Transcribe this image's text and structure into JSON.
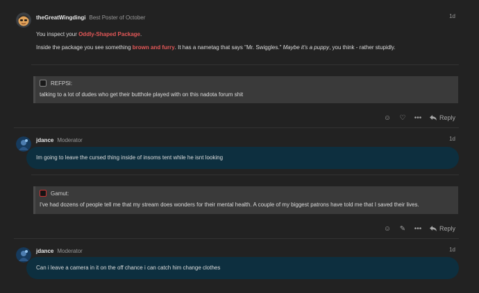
{
  "posts": [
    {
      "username": "theGreatWingdingi",
      "user_title": "Best Poster of October",
      "date": "1d",
      "line1_prefix": "You inspect your ",
      "line1_highlight": "Oddly-Shaped Package",
      "line1_suffix": ".",
      "line2_prefix": "Inside the package you see something ",
      "line2_highlight": "brown and furry",
      "line2_middle": ". It has a nametag that says \"Mr. Swiggles.\" ",
      "line2_italic": "Maybe it's a puppy",
      "line2_suffix": ", you think - rather stupidly.",
      "quote": {
        "author": "REFPSI:",
        "text": "talking to a lot of dudes who get their butthole played with on this nadota forum shit"
      },
      "actions": {
        "icons": [
          "smiley-icon",
          "heart-icon",
          "more-icon"
        ],
        "reply_label": "Reply"
      }
    },
    {
      "username": "jdance",
      "user_title": "Moderator",
      "date": "1d",
      "text": "Im going to leave the cursed thing inside of insoms tent while he isnt looking",
      "quote": {
        "author": "Gamut:",
        "text": "I've had dozens of people tell me that my stream does wonders for their mental health. A couple of my biggest patrons have told me that I saved their lives."
      },
      "actions": {
        "icons": [
          "smiley-icon",
          "pencil-icon",
          "more-icon"
        ],
        "reply_label": "Reply"
      }
    },
    {
      "username": "jdance",
      "user_title": "Moderator",
      "date": "1d",
      "text": "Can i leave a camera in it on the off chance i can catch him change clothes"
    }
  ],
  "colors": {
    "background": "#222222",
    "highlight_red": "#e45858",
    "moderator_bubble": "#0d2f3f",
    "quote_bg": "#3a3a3a"
  }
}
